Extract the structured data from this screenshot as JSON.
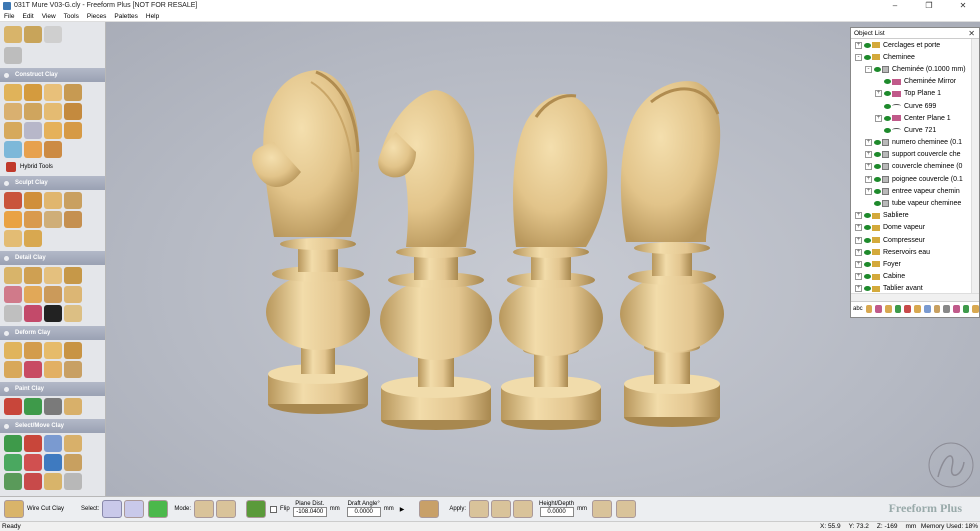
{
  "window": {
    "title": "031T Mure V03-G.cly - Freeform Plus [NOT FOR RESALE]"
  },
  "menu": [
    "File",
    "Edit",
    "View",
    "Tools",
    "Pieces",
    "Palettes",
    "Help"
  ],
  "left_toolbar": {
    "sections": [
      {
        "label": "Construct Clay",
        "icon": "construct-icon"
      },
      {
        "label": "Sculpt Clay",
        "icon": "sculpt-icon"
      },
      {
        "label": "Detail Clay",
        "icon": "detail-icon"
      },
      {
        "label": "Deform Clay",
        "icon": "deform-icon"
      },
      {
        "label": "Paint Clay",
        "icon": "paint-icon"
      },
      {
        "label": "Select/Move Clay",
        "icon": "select-icon"
      }
    ],
    "hybrid_tools_label": "Hybrid Tools",
    "wire_cut_label": "Wire Cut Clay"
  },
  "object_list": {
    "title": "Object List",
    "rows": [
      {
        "label": "Cerclages et porte",
        "type": "folder",
        "depth": 0,
        "expander": "+"
      },
      {
        "label": "Cheminee",
        "type": "folder",
        "depth": 0,
        "expander": "-"
      },
      {
        "label": "Cheminée (0.1000 mm)",
        "type": "cube",
        "depth": 1,
        "expander": "-"
      },
      {
        "label": "Cheminée Mirror",
        "type": "plane",
        "depth": 2,
        "expander": ""
      },
      {
        "label": "Top Plane 1",
        "type": "plane",
        "depth": 2,
        "expander": "+"
      },
      {
        "label": "Curve 699",
        "type": "curve",
        "depth": 2,
        "expander": ""
      },
      {
        "label": "Center Plane 1",
        "type": "plane",
        "depth": 2,
        "expander": "+"
      },
      {
        "label": "Curve 721",
        "type": "curve",
        "depth": 2,
        "expander": ""
      },
      {
        "label": "numero cheminee (0.1",
        "type": "cube",
        "depth": 1,
        "expander": "+"
      },
      {
        "label": "support couvercle che",
        "type": "cube",
        "depth": 1,
        "expander": "+"
      },
      {
        "label": "couvercle cheminee (0",
        "type": "cube",
        "depth": 1,
        "expander": "+"
      },
      {
        "label": "poignee couvercle (0.1",
        "type": "cube",
        "depth": 1,
        "expander": "+"
      },
      {
        "label": "entree vapeur chemin",
        "type": "cube",
        "depth": 1,
        "expander": "+"
      },
      {
        "label": "tube vapeur cheminee",
        "type": "cube",
        "depth": 1,
        "expander": ""
      },
      {
        "label": "Sabliere",
        "type": "folder",
        "depth": 0,
        "expander": "+"
      },
      {
        "label": "Dome vapeur",
        "type": "folder",
        "depth": 0,
        "expander": "+"
      },
      {
        "label": "Compresseur",
        "type": "folder",
        "depth": 0,
        "expander": "+"
      },
      {
        "label": "Reservoirs eau",
        "type": "folder",
        "depth": 0,
        "expander": "+"
      },
      {
        "label": "Foyer",
        "type": "folder",
        "depth": 0,
        "expander": "+"
      },
      {
        "label": "Cabine",
        "type": "folder",
        "depth": 0,
        "expander": "+"
      },
      {
        "label": "Tablier avant",
        "type": "folder",
        "depth": 0,
        "expander": "+"
      }
    ],
    "footer_label": "abc"
  },
  "bottom_toolbar": {
    "select_label": "Select:",
    "mode_label": "Mode:",
    "flip_label": "Flip",
    "plane_dist_label": "Plane Dist.",
    "plane_dist_value": "-108.0400",
    "plane_dist_unit": "mm",
    "draft_angle_label": "Draft Angle°",
    "draft_angle_value": "0.0000",
    "draft_unit": "mm",
    "apply_label": "Apply:",
    "height_depth_label": "Height/Depth",
    "height_depth_value": "0.0000",
    "height_unit": "mm",
    "brand": "Freeform Plus"
  },
  "status": {
    "ready": "Ready",
    "x": "X: 55.9",
    "y": "Y: 73.2",
    "z": "Z: -169",
    "unit": "mm",
    "memory": "Memory Used: 18%"
  },
  "colors": {
    "clay": "#e6cc96",
    "viewport_bg": "#b6bac4",
    "section_header": "#9aa1b3"
  }
}
